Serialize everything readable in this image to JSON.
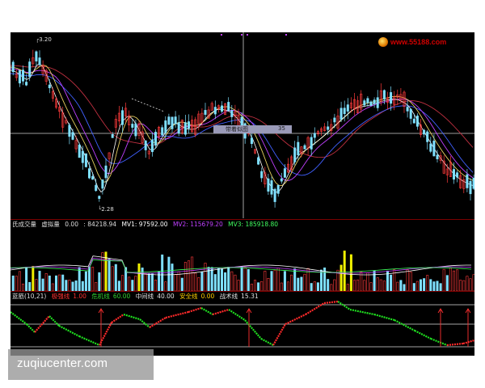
{
  "price_pane": {
    "high_label": "3.20",
    "low_label": "2.28",
    "tooltip_label": "带着似图",
    "tooltip_value": "35",
    "logo_text": "www.55188.com"
  },
  "volume_pane": {
    "title": "氏成交量",
    "name": "虚拟量",
    "name_value": "0.00",
    "value": ": 84218.94",
    "mv1": "MV1: 97592.00",
    "mv2": "MV2: 115679.20",
    "mv3": "MV3: 185918.80"
  },
  "indicator_pane": {
    "title": "蓝筋(10,21)",
    "items": [
      {
        "label": "极强线",
        "value": "1.00",
        "color": "#ff3030"
      },
      {
        "label": "危机线",
        "value": "60.00",
        "color": "#30d030"
      },
      {
        "label": "中间线",
        "value": "40.00",
        "color": "#e0e0e0"
      },
      {
        "label": "安全线",
        "value": "0.00",
        "color": "#ffd000"
      },
      {
        "label": "战术线",
        "value": "15.31",
        "color": "#e0e0e0"
      }
    ]
  },
  "watermark": "zuqiucenter.com",
  "colors": {
    "up": "#ff3b3b",
    "down": "#7fe0ff",
    "ma_white": "#ffffff",
    "ma_yellow": "#e8d060",
    "ma_purple": "#c040ff",
    "ma_green": "#40ff60",
    "ma_blue": "#4060ff",
    "ma_red": "#c03040",
    "volume_highlight": "#f0f000"
  }
}
